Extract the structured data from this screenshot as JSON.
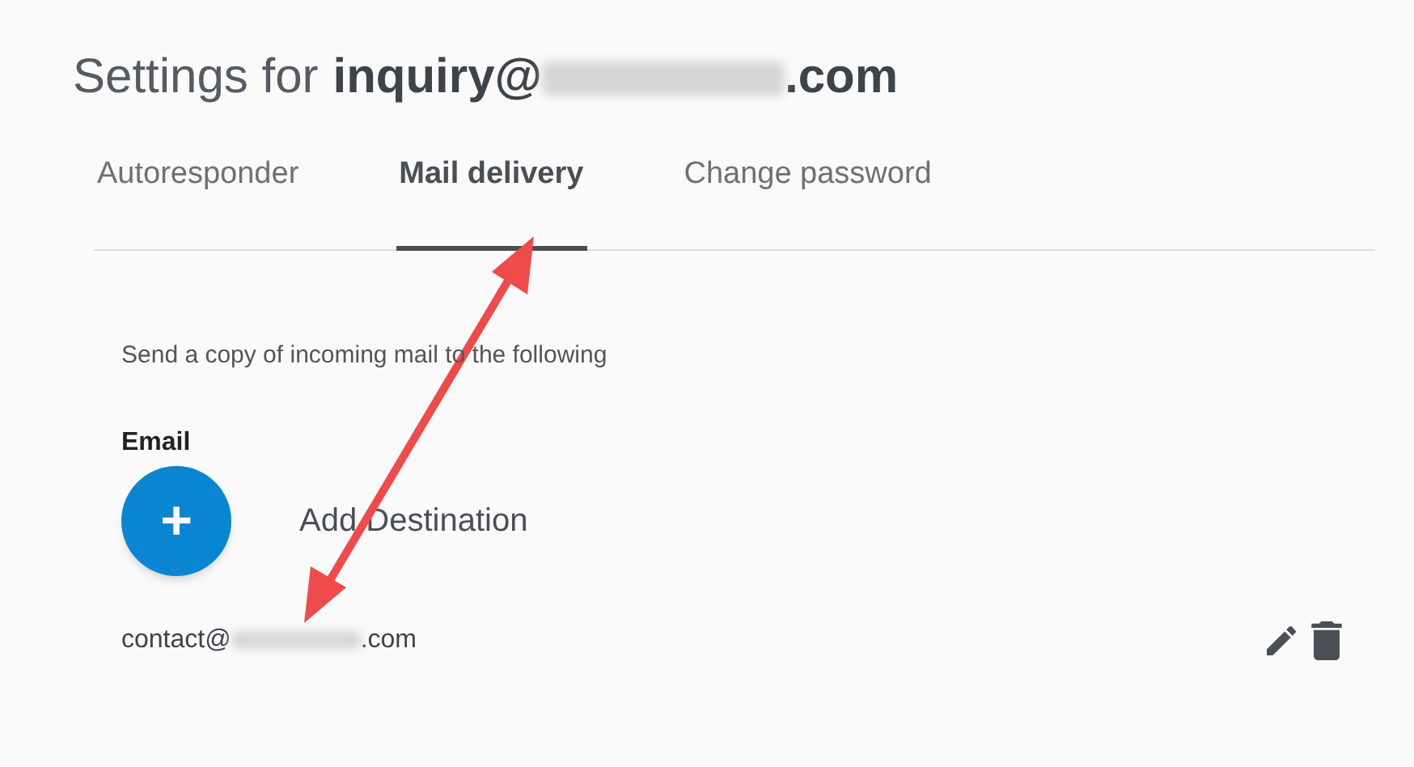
{
  "title": {
    "prefix": "Settings for",
    "account_start": "inquiry@",
    "account_end": ".com"
  },
  "tabs": [
    {
      "label": "Autoresponder",
      "selected": false
    },
    {
      "label": "Mail delivery",
      "selected": true
    },
    {
      "label": "Change password",
      "selected": false
    }
  ],
  "description": "Send a copy of incoming mail to the following",
  "field_label": "Email",
  "add_button": {
    "icon": "+",
    "label": "Add Destination"
  },
  "destinations": [
    {
      "start": "contact@",
      "end": ".com"
    }
  ]
}
